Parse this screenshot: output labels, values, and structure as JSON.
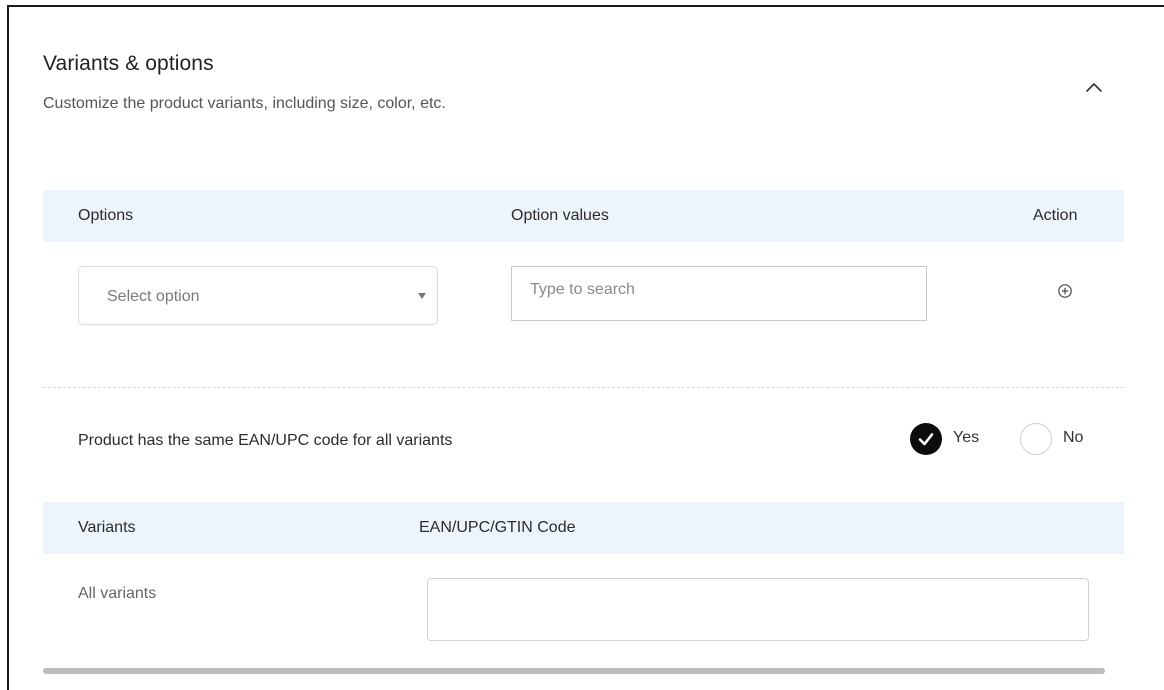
{
  "section": {
    "title": "Variants & options",
    "subtitle": "Customize the product variants, including size, color, etc."
  },
  "options_table": {
    "headers": [
      "Options",
      "Option values",
      "Action"
    ],
    "select": {
      "value": "Select option"
    },
    "values_input": {
      "placeholder": "Type to search",
      "value": ""
    }
  },
  "ean_question": {
    "label": "Product has the same EAN/UPC code for all variants",
    "options": [
      "Yes",
      "No"
    ],
    "selected": "Yes"
  },
  "variants_table": {
    "headers": [
      "Variants",
      "EAN/UPC/GTIN Code"
    ],
    "rows": [
      {
        "variant": "All variants",
        "code": ""
      }
    ]
  },
  "icons": {
    "collapse": "chevron-up-icon",
    "add": "add-circle-icon",
    "check": "check-icon",
    "dropdown": "caret-down-icon"
  },
  "colors": {
    "header_bg": "#eef4fc",
    "selected_radio": "#0c0c0c"
  }
}
